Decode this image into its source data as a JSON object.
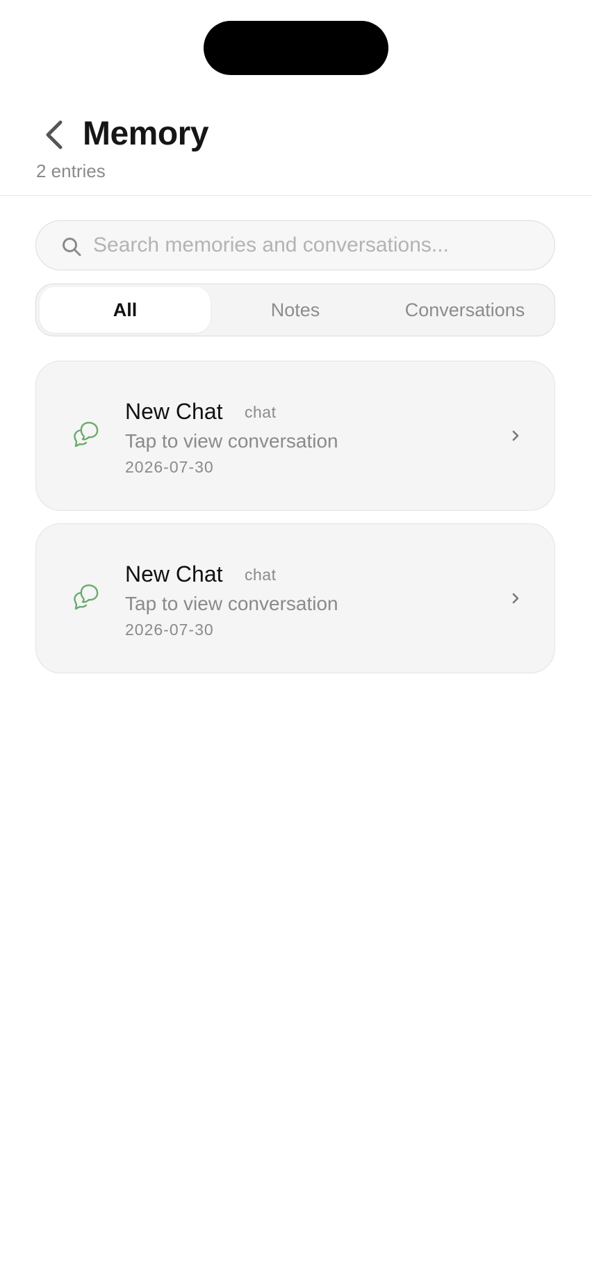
{
  "header": {
    "title": "Memory",
    "subtitle": "2 entries"
  },
  "search": {
    "placeholder": "Search memories and conversations..."
  },
  "filter_tabs": [
    {
      "label": "All",
      "active": true
    },
    {
      "label": "Notes",
      "active": false
    },
    {
      "label": "Conversations",
      "active": false
    }
  ],
  "entries": [
    {
      "title": "New Chat",
      "type": "chat",
      "subtitle": "Tap to view conversation",
      "date": "2026-07-30",
      "icon": "chat-bubbles-icon"
    },
    {
      "title": "New Chat",
      "type": "chat",
      "subtitle": "Tap to view conversation",
      "date": "2026-07-30",
      "icon": "chat-bubbles-icon"
    }
  ],
  "colors": {
    "accent_green": "#6aaa6d",
    "text_primary": "#161616",
    "text_secondary": "#8a8a8a"
  }
}
